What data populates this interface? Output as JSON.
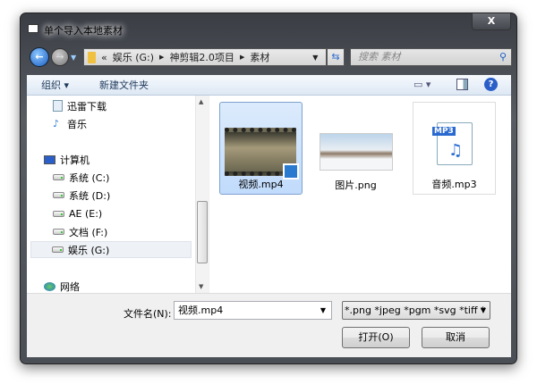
{
  "window": {
    "title": "单个导入本地素材",
    "close_label": "X"
  },
  "address": {
    "overflow": "«",
    "crumbs": [
      "娱乐 (G:)",
      "神剪辑2.0项目",
      "素材"
    ]
  },
  "search": {
    "placeholder": "搜索 素材"
  },
  "toolbar": {
    "organize": "组织 ▾",
    "new_folder": "新建文件夹"
  },
  "sidebar": {
    "items": [
      {
        "label": "迅雷下载"
      },
      {
        "label": "音乐"
      },
      {
        "label": "计算机"
      },
      {
        "label": "系统 (C:)"
      },
      {
        "label": "系统 (D:)"
      },
      {
        "label": "AE (E:)"
      },
      {
        "label": "文档 (F:)"
      },
      {
        "label": "娱乐 (G:)"
      },
      {
        "label": "网络"
      }
    ]
  },
  "files": [
    {
      "name": "视频.mp4",
      "selected": true
    },
    {
      "name": "图片.png"
    },
    {
      "name": "音频.mp3",
      "badge": "MP3"
    }
  ],
  "bottom": {
    "filename_label": "文件名(N):",
    "filename_value": "视频.mp4",
    "filter": "*.png *jpeg *pgm *svg *tiff *",
    "open": "打开(O)",
    "cancel": "取消"
  }
}
